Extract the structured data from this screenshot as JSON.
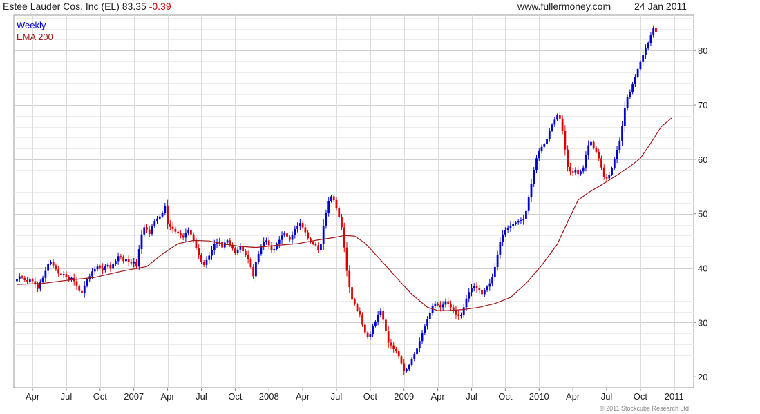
{
  "header": {
    "title": "Estee Lauder Cos. Inc (EL)",
    "price": "83.35",
    "change": "-0.39",
    "website": "www.fullermoney.com",
    "date": "24 Jan 2011"
  },
  "footer": {
    "copyright": "© 2011 Stockcube Research Ltd"
  },
  "colors": {
    "up": "#0000cc",
    "down": "#dd0000",
    "ema": "#a01818",
    "grid": "#dcdcdc",
    "legend_weekly": "#0000cc",
    "legend_ema": "#a01818"
  },
  "chart_data": {
    "type": "candlestick",
    "title": "Estee Lauder Cos. Inc (EL)",
    "legend": [
      "Weekly",
      "EMA 200"
    ],
    "legend_position": "top-left",
    "y_axis_position": "right",
    "grid": true,
    "ylim": [
      18,
      86.5
    ],
    "y_ticks": [
      20,
      30,
      40,
      50,
      60,
      70,
      80
    ],
    "x_ticks": [
      "Apr",
      "Jul",
      "Oct",
      "2007",
      "Apr",
      "Jul",
      "Oct",
      "2008",
      "Apr",
      "Jul",
      "Oct",
      "2009",
      "Apr",
      "Jul",
      "Oct",
      "2010",
      "Apr",
      "Jul",
      "Oct",
      "2011"
    ],
    "x_range": [
      0,
      213
    ],
    "x_tick_positions": [
      6,
      19,
      32,
      45,
      58,
      71,
      84,
      97,
      110,
      123,
      136,
      149,
      162,
      175,
      188,
      201,
      214,
      227,
      240,
      253
    ],
    "weekly_close": [
      38,
      38.5,
      38.2,
      37.8,
      37.5,
      37.9,
      37.6,
      37,
      36.2,
      37.4,
      38.2,
      39.5,
      40.8,
      41.2,
      40.5,
      39.8,
      39,
      38.7,
      38.9,
      38.4,
      37.8,
      38.2,
      37.6,
      36.8,
      35.8,
      35.4,
      36.8,
      37.9,
      38.5,
      39.4,
      39.8,
      40.3,
      40.1,
      39.7,
      40.3,
      40.6,
      39.9,
      40.7,
      41.3,
      42.2,
      42,
      41.3,
      41.6,
      41.2,
      40.9,
      41.1,
      40.3,
      43.5,
      46.2,
      47.5,
      47.1,
      46.3,
      47.8,
      48.6,
      49.1,
      49.5,
      50.2,
      51.5,
      48.2,
      47.6,
      47.2,
      46.7,
      46.4,
      46,
      45.6,
      46.5,
      47,
      46.2,
      45.1,
      43.7,
      42.4,
      41.1,
      40.6,
      41.5,
      42.3,
      43.3,
      44.4,
      44.7,
      44.9,
      43.8,
      44.7,
      45.1,
      44.3,
      43.6,
      42.8,
      43.4,
      44,
      43.1,
      42.4,
      41.7,
      40.2,
      38.5,
      41.2,
      42.6,
      44.1,
      44.8,
      45.1,
      44.2,
      43.3,
      43.5,
      44.4,
      45.2,
      46,
      46.4,
      45.8,
      45.2,
      46.1,
      47.2,
      47.8,
      48.3,
      47.5,
      46.6,
      45.5,
      44.8,
      44.5,
      44.2,
      43.3,
      44.5,
      47.8,
      50.2,
      52.3,
      53.2,
      52.5,
      51.1,
      49.4,
      47.5,
      43.8,
      39.5,
      36.5,
      34.2,
      33.4,
      32.2,
      31.5,
      29.6,
      28.2,
      27.3,
      27.9,
      29.3,
      30.2,
      31.4,
      32.1,
      30.5,
      28.4,
      26.3,
      25.8,
      25.1,
      24.7,
      23.8,
      22.5,
      21.1,
      21.4,
      22.2,
      23.3,
      24.2,
      25.2,
      26.6,
      28.1,
      29.3,
      30.6,
      31.8,
      33,
      33.5,
      33.2,
      32.8,
      33.3,
      33.9,
      33.4,
      32.8,
      32.3,
      31.5,
      31.2,
      31.4,
      32.8,
      34.4,
      35.6,
      36.3,
      36.7,
      36.3,
      35.9,
      35.2,
      35.9,
      36.6,
      37.2,
      38.4,
      40.2,
      42.5,
      44.8,
      46.2,
      47,
      47.4,
      47.8,
      48.1,
      48.4,
      48.6,
      48.8,
      49,
      50.5,
      53,
      55.5,
      58,
      60.2,
      61.5,
      62.3,
      62.8,
      63.8,
      65.2,
      66.4,
      67.3,
      68.1,
      67.5,
      65.2,
      61.8,
      58.6,
      57.8,
      57.5,
      58.1,
      57.3,
      57.8,
      58.5,
      60.8,
      62.6,
      63.2,
      62.1,
      61.4,
      60.2,
      58.5,
      56.8,
      56.5,
      57.2,
      58.4,
      60.1,
      61.7,
      63.4,
      66.2,
      69.4,
      71.5,
      72.4,
      73.8,
      75.2,
      76.6,
      77.9,
      79.2,
      80.4,
      81.4,
      82.8,
      84.2,
      83.35
    ],
    "ema200_points": [
      [
        0,
        37
      ],
      [
        10,
        37.2
      ],
      [
        20,
        37.8
      ],
      [
        30,
        38.3
      ],
      [
        40,
        39.4
      ],
      [
        50,
        40.3
      ],
      [
        56,
        42.6
      ],
      [
        62,
        44.5
      ],
      [
        68,
        45.1
      ],
      [
        74,
        45
      ],
      [
        80,
        44.4
      ],
      [
        86,
        44
      ],
      [
        92,
        43.8
      ],
      [
        100,
        44.2
      ],
      [
        108,
        44.5
      ],
      [
        116,
        45.2
      ],
      [
        122,
        45.6
      ],
      [
        126,
        46
      ],
      [
        130,
        45.9
      ],
      [
        134,
        44.6
      ],
      [
        140,
        41.5
      ],
      [
        146,
        38.3
      ],
      [
        152,
        35.2
      ],
      [
        158,
        32.8
      ],
      [
        162,
        32.2
      ],
      [
        166,
        32.2
      ],
      [
        172,
        32.4
      ],
      [
        178,
        32.8
      ],
      [
        184,
        33.5
      ],
      [
        190,
        34.6
      ],
      [
        196,
        37.2
      ],
      [
        202,
        40.5
      ],
      [
        208,
        44.4
      ],
      [
        212,
        48.5
      ],
      [
        216,
        52.5
      ],
      [
        220,
        53.9
      ],
      [
        224,
        55
      ],
      [
        228,
        56.2
      ],
      [
        232,
        57.4
      ],
      [
        236,
        58.7
      ],
      [
        240,
        60.2
      ],
      [
        244,
        63
      ],
      [
        248,
        66
      ],
      [
        252,
        67.6
      ]
    ]
  }
}
